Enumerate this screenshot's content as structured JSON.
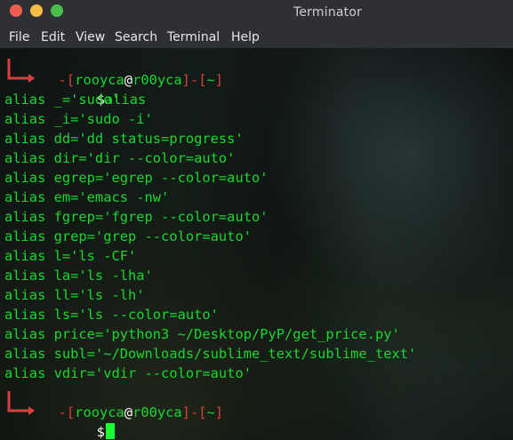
{
  "window": {
    "title": "Terminator",
    "colors": {
      "close": "#ef5b4c",
      "minimize": "#f6bd40",
      "maximize": "#49c04b"
    }
  },
  "menu": {
    "file": "File",
    "edit": "Edit",
    "view": "View",
    "search": "Search",
    "terminal": "Terminal",
    "help": "Help"
  },
  "prompt": {
    "lbr": "[",
    "user": "rooyca",
    "at": "@",
    "host": "r00yca",
    "rbr": "]",
    "dash": "-",
    "path_open": "[",
    "path": "~",
    "path_close": "]",
    "dollar": "$",
    "command": "alias"
  },
  "aliases": [
    "alias _='sudo'",
    "alias _i='sudo -i'",
    "alias dd='dd status=progress'",
    "alias dir='dir --color=auto'",
    "alias egrep='egrep --color=auto'",
    "alias em='emacs -nw'",
    "alias fgrep='fgrep --color=auto'",
    "alias grep='grep --color=auto'",
    "alias l='ls -CF'",
    "alias la='ls -lha'",
    "alias ll='ls -lh'",
    "alias ls='ls --color=auto'",
    "alias price='python3 ~/Desktop/PyP/get_price.py'",
    "alias subl='~/Downloads/sublime_text/sublime_text'",
    "alias vdir='vdir --color=auto'"
  ],
  "theme": {
    "accent": "#d8403b",
    "text": "#19d82d",
    "cursor": "#1aff35"
  }
}
